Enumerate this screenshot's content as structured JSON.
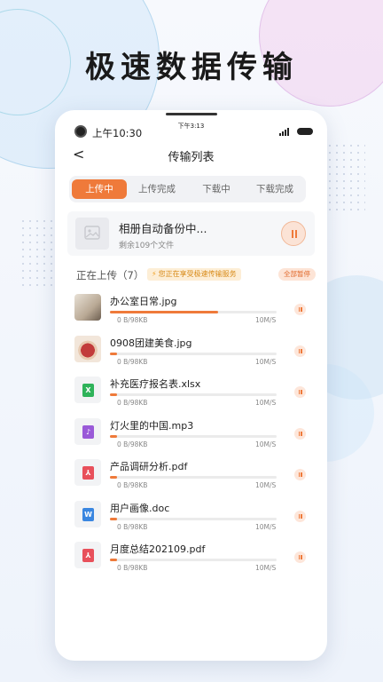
{
  "headline": "极速数据传输",
  "status_bar": {
    "time_left": "上午10:30",
    "time_center": "下午3:13"
  },
  "nav": {
    "back": "<",
    "title": "传输列表"
  },
  "tabs": [
    {
      "label": "上传中",
      "active": true
    },
    {
      "label": "上传完成",
      "active": false
    },
    {
      "label": "下载中",
      "active": false
    },
    {
      "label": "下载完成",
      "active": false
    }
  ],
  "backup": {
    "title": "相册自动备份中...",
    "subtitle": "剩余109个文件"
  },
  "section": {
    "title": "正在上传（7）",
    "speed_badge": "您正在享受极速传输服务",
    "pause_all": "全部暂停"
  },
  "accent_color": "#ef7a3a",
  "files": [
    {
      "name": "办公室日常.jpg",
      "size": "0 B/98KB",
      "speed": "10M/S",
      "progress": 0.65,
      "icon": "photo-thumbnail"
    },
    {
      "name": "0908团建美食.jpg",
      "size": "0 B/98KB",
      "speed": "10M/S",
      "progress": 0.04,
      "icon": "photo-thumbnail"
    },
    {
      "name": "补充医疗报名表.xlsx",
      "size": "0 B/98KB",
      "speed": "10M/S",
      "progress": 0.04,
      "icon": "excel-icon",
      "icon_glyph": "X",
      "icon_color": "#2fb35a"
    },
    {
      "name": "灯火里的中国.mp3",
      "size": "0 B/98KB",
      "speed": "10M/S",
      "progress": 0.04,
      "icon": "music-icon",
      "icon_glyph": "♪",
      "icon_color": "#9a5ad8"
    },
    {
      "name": "产品调研分析.pdf",
      "size": "0 B/98KB",
      "speed": "10M/S",
      "progress": 0.04,
      "icon": "pdf-icon",
      "icon_glyph": "⅄",
      "icon_color": "#e8505b"
    },
    {
      "name": "用户画像.doc",
      "size": "0 B/98KB",
      "speed": "10M/S",
      "progress": 0.04,
      "icon": "word-icon",
      "icon_glyph": "W",
      "icon_color": "#3a86e0"
    },
    {
      "name": "月度总结202109.pdf",
      "size": "0 B/98KB",
      "speed": "10M/S",
      "progress": 0.04,
      "icon": "pdf-icon",
      "icon_glyph": "⅄",
      "icon_color": "#e8505b"
    }
  ]
}
